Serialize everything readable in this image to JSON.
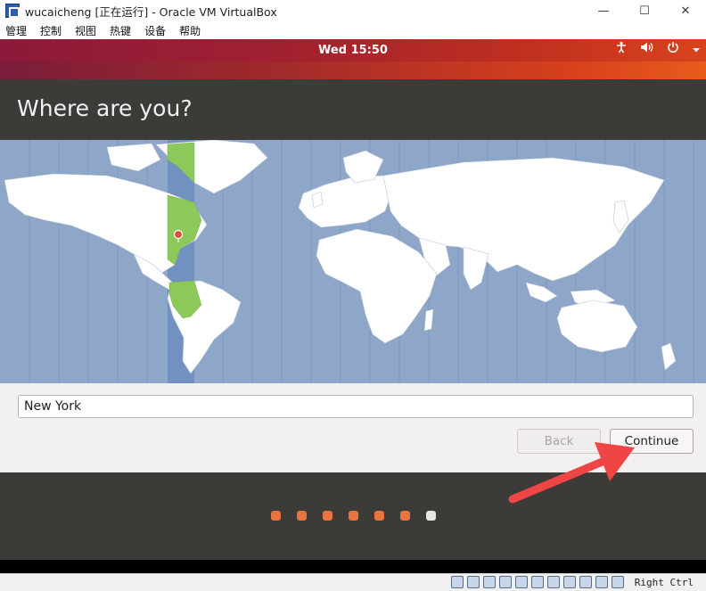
{
  "window": {
    "title": "wucaicheng [正在运行] - Oracle VM VirtualBox",
    "minimize_glyph": "—",
    "maximize_glyph": "☐",
    "close_glyph": "✕"
  },
  "menu": {
    "items": [
      "管理",
      "控制",
      "视图",
      "热键",
      "设备",
      "帮助"
    ]
  },
  "panel": {
    "clock": "Wed 15:50",
    "tray_icons": [
      "accessibility-icon",
      "volume-icon",
      "power-icon",
      "chevron-down-icon"
    ]
  },
  "installer": {
    "title": "Where are you?",
    "location_value": "New York",
    "back_label": "Back",
    "continue_label": "Continue",
    "progress": {
      "steps_total": 7,
      "current_step": 7
    }
  },
  "statusbar": {
    "host_key": "Right Ctrl"
  },
  "colors": {
    "header_bg": "#3c3b37",
    "map_ocean": "#8ea6c8",
    "selected_timezone": "#8cc85a",
    "progress_dot": "#e9743e",
    "annotation_arrow": "#f04545"
  }
}
